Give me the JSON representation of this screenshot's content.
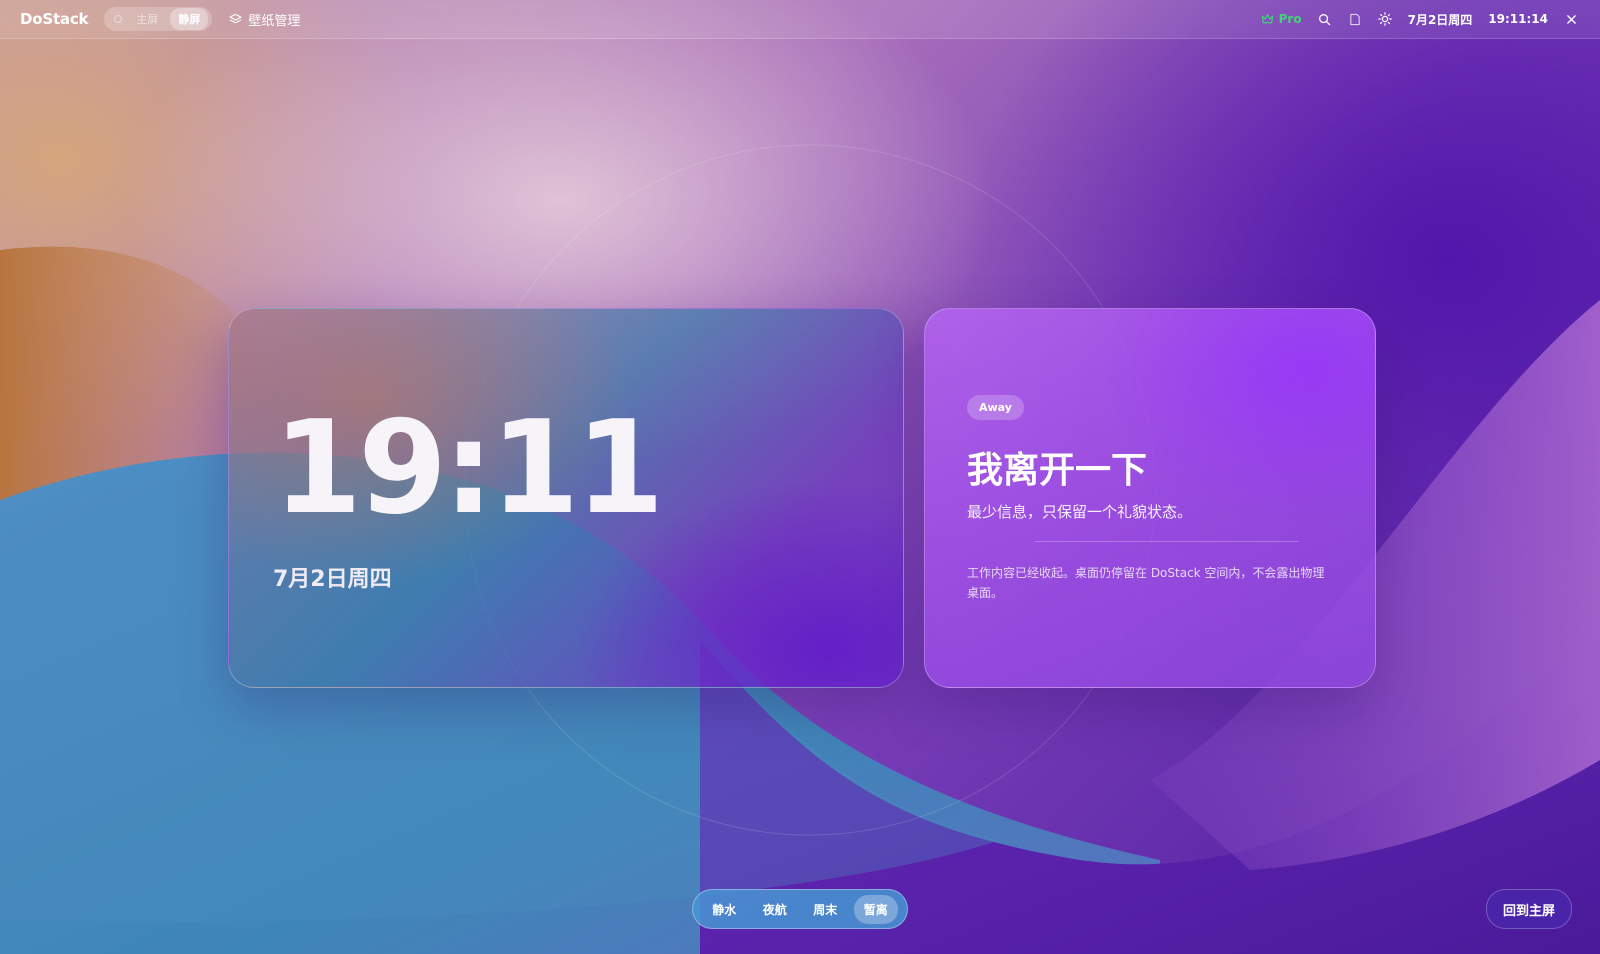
{
  "topbar": {
    "brand": "DoStack",
    "modes": [
      {
        "label": "主屏",
        "active": false
      },
      {
        "label": "静屏",
        "active": true
      }
    ],
    "wallpaper_label": "壁纸管理",
    "pro_label": "Pro",
    "date": "7月2日周四",
    "time": "19:11:14",
    "icons": [
      "crown-icon",
      "search-icon",
      "window-icon",
      "sun-icon",
      "close-icon"
    ]
  },
  "clock_card": {
    "time": "19:11",
    "date": "7月2日周四"
  },
  "away_card": {
    "badge": "Away",
    "title": "我离开一下",
    "subtitle": "最少信息，只保留一个礼貌状态。",
    "description": "工作内容已经收起。桌面仍停留在 DoStack 空间内，不会露出物理桌面。"
  },
  "scenes": {
    "items": [
      {
        "label": "静水",
        "active": false
      },
      {
        "label": "夜航",
        "active": false
      },
      {
        "label": "周末",
        "active": false
      },
      {
        "label": "暂离",
        "active": true
      }
    ]
  },
  "home_button": {
    "label": "回到主屏"
  },
  "colors": {
    "accent_green": "#43d27a",
    "home_button": "#4a24a8",
    "scene_switch": "#4696d2"
  }
}
